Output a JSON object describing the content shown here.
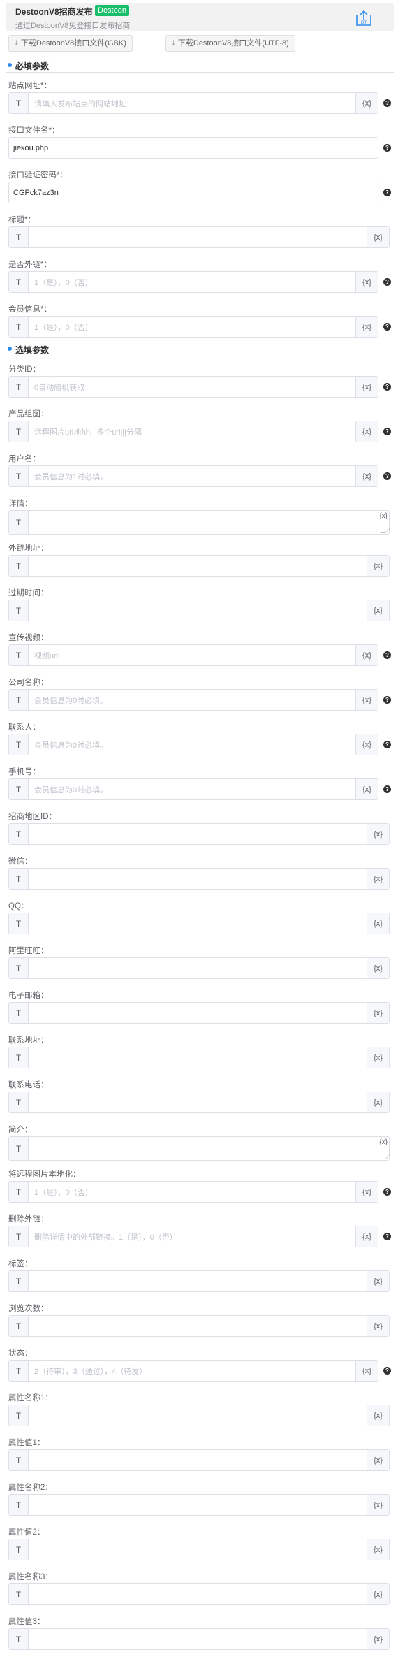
{
  "header": {
    "title": "DestoonV8招商发布",
    "badge": "Destoon",
    "subtitle": "通过DestoonV8免登接口发布招商",
    "upload_icon": "upload-icon",
    "upload_icon_text": "DT"
  },
  "download_buttons": [
    {
      "label": "下载DestoonV8接口文件(GBK)",
      "icon": "download-icon"
    },
    {
      "label": "下载DestoonV8接口文件(UTF-8)",
      "icon": "download-icon"
    }
  ],
  "sections": {
    "required": "必填参数",
    "optional": "选填参数"
  },
  "common": {
    "type_prefix": "T",
    "var_button": "{x}",
    "help": "?"
  },
  "required_fields": [
    {
      "label": "站点网址*：",
      "kind": "prefixed",
      "placeholder": "请填入发布站点的网站地址",
      "help": true
    },
    {
      "label": "接口文件名*：",
      "kind": "plain",
      "value": "jiekou.php",
      "help": true
    },
    {
      "label": "接口验证密码*：",
      "kind": "plain",
      "value": "CGPck7az3n",
      "help": true
    },
    {
      "label": "标题*：",
      "kind": "prefixed",
      "placeholder": "",
      "help": false
    },
    {
      "label": "是否外链*：",
      "kind": "prefixed",
      "placeholder": "1（是），0（否）",
      "help": true
    },
    {
      "label": "会员信息*：",
      "kind": "prefixed",
      "placeholder": "1（是），0（否）",
      "help": true
    }
  ],
  "optional_fields": [
    {
      "label": "分类ID：",
      "kind": "prefixed",
      "placeholder": "0自动随机获取",
      "help": true
    },
    {
      "label": "产品组图：",
      "kind": "prefixed",
      "placeholder": "远程图片url地址，多个url|||分隔",
      "help": true
    },
    {
      "label": "用户名：",
      "kind": "prefixed",
      "placeholder": "会员信息为1时必填。",
      "help": true
    },
    {
      "label": "详情：",
      "kind": "textarea",
      "placeholder": "",
      "help": false
    },
    {
      "label": "外链地址：",
      "kind": "prefixed",
      "placeholder": "",
      "help": false
    },
    {
      "label": "过期时间：",
      "kind": "prefixed",
      "placeholder": "",
      "help": false
    },
    {
      "label": "宣传视频：",
      "kind": "prefixed",
      "placeholder": "视频url",
      "help": true
    },
    {
      "label": "公司名称：",
      "kind": "prefixed",
      "placeholder": "会员信息为0时必填。",
      "help": true
    },
    {
      "label": "联系人：",
      "kind": "prefixed",
      "placeholder": "会员信息为0时必填。",
      "help": true
    },
    {
      "label": "手机号：",
      "kind": "prefixed",
      "placeholder": "会员信息为0时必填。",
      "help": true
    },
    {
      "label": "招商地区ID：",
      "kind": "prefixed",
      "placeholder": "",
      "help": false
    },
    {
      "label": "微信：",
      "kind": "prefixed",
      "placeholder": "",
      "help": false
    },
    {
      "label": "QQ：",
      "kind": "prefixed",
      "placeholder": "",
      "help": false
    },
    {
      "label": "阿里旺旺：",
      "kind": "prefixed",
      "placeholder": "",
      "help": false
    },
    {
      "label": "电子邮箱：",
      "kind": "prefixed",
      "placeholder": "",
      "help": false
    },
    {
      "label": "联系地址：",
      "kind": "prefixed",
      "placeholder": "",
      "help": false
    },
    {
      "label": "联系电话：",
      "kind": "prefixed",
      "placeholder": "",
      "help": false
    },
    {
      "label": "简介：",
      "kind": "textarea",
      "placeholder": "",
      "help": false
    },
    {
      "label": "将远程图片本地化：",
      "kind": "prefixed",
      "placeholder": "1（是），0（否）",
      "help": true
    },
    {
      "label": "删除外链：",
      "kind": "prefixed",
      "placeholder": "删除详情中的外部链接。1（是），0（否）",
      "help": true
    },
    {
      "label": "标签：",
      "kind": "prefixed",
      "placeholder": "",
      "help": false
    },
    {
      "label": "浏览次数：",
      "kind": "prefixed",
      "placeholder": "",
      "help": false
    },
    {
      "label": "状态：",
      "kind": "prefixed",
      "placeholder": "2（待审），3（通过），4（待发）",
      "help": true
    },
    {
      "label": "属性名称1：",
      "kind": "prefixed",
      "placeholder": "",
      "help": false
    },
    {
      "label": "属性值1：",
      "kind": "prefixed",
      "placeholder": "",
      "help": false
    },
    {
      "label": "属性名称2：",
      "kind": "prefixed",
      "placeholder": "",
      "help": false
    },
    {
      "label": "属性值2：",
      "kind": "prefixed",
      "placeholder": "",
      "help": false
    },
    {
      "label": "属性名称3：",
      "kind": "prefixed",
      "placeholder": "",
      "help": false
    },
    {
      "label": "属性值3：",
      "kind": "prefixed",
      "placeholder": "",
      "help": false
    }
  ]
}
